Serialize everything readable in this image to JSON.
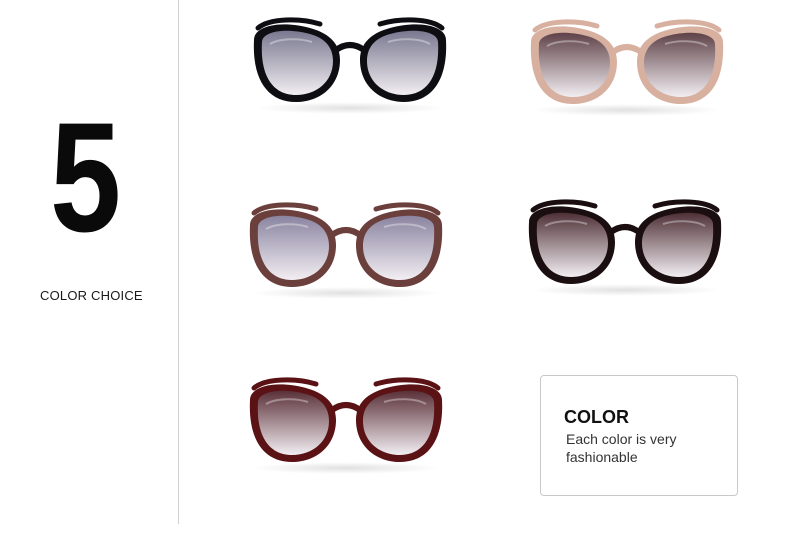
{
  "feature": {
    "number": "5",
    "label": "COLOR CHOICE"
  },
  "card": {
    "title": "COLOR",
    "description": "Each color is very fashionable"
  },
  "variants": [
    {
      "name": "black-gradient-gray",
      "frame": "#0d0d12",
      "lens": "#7a7890"
    },
    {
      "name": "champagne-gradient-brown",
      "frame": "#d8b0a0",
      "lens": "#5e4248"
    },
    {
      "name": "mocha-gradient-lilac",
      "frame": "#6b3f3c",
      "lens": "#8a84a0"
    },
    {
      "name": "black-tortoise-gradient-brown",
      "frame": "#1a0e10",
      "lens": "#4e3036"
    },
    {
      "name": "wine-red-gradient-brown",
      "frame": "#5a1214",
      "lens": "#5a3038"
    }
  ]
}
